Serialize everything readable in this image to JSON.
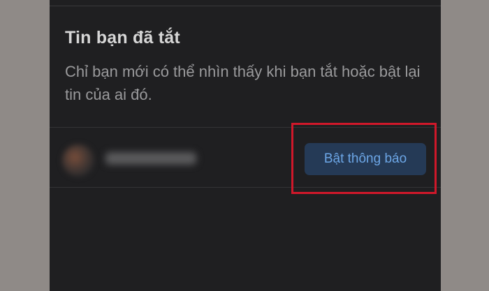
{
  "muted_stories": {
    "title": "Tin bạn đã tắt",
    "description": "Chỉ bạn mới có thể nhìn thấy khi bạn tắt hoặc bật lại tin của ai đó.",
    "rows": [
      {
        "button_label": "Bật thông báo"
      }
    ]
  },
  "colors": {
    "background": "#1f1f21",
    "button_bg": "#253a56",
    "button_text": "#6ca6e6",
    "highlight": "#d0182a"
  }
}
